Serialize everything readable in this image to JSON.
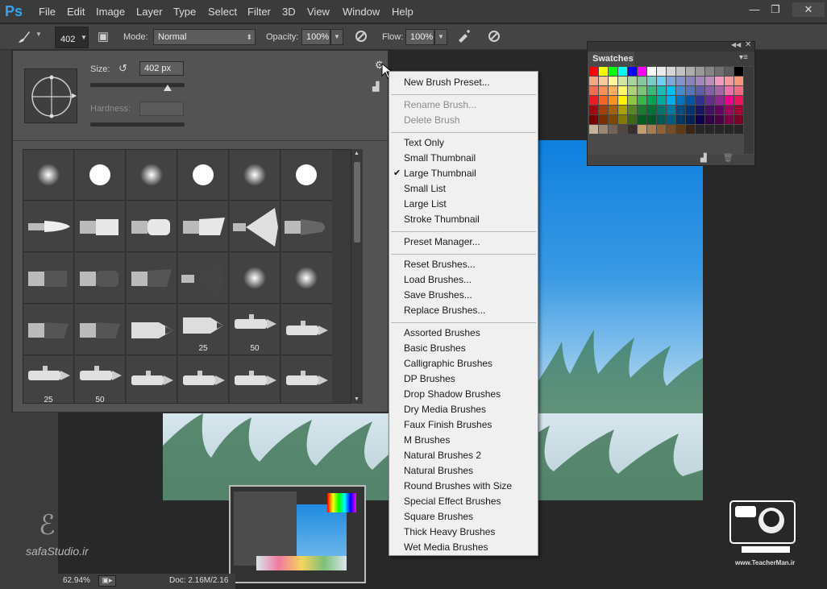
{
  "app": {
    "logo": "Ps"
  },
  "menubar": {
    "items": [
      "File",
      "Edit",
      "Image",
      "Layer",
      "Type",
      "Select",
      "Filter",
      "3D",
      "View",
      "Window",
      "Help"
    ],
    "window_controls": {
      "minimize": "—",
      "restore": "❐",
      "close": "✕"
    }
  },
  "options_bar": {
    "brush_size": "402",
    "mode_label": "Mode:",
    "mode_value": "Normal",
    "opacity_label": "Opacity:",
    "opacity_value": "100%",
    "flow_label": "Flow:",
    "flow_value": "100%"
  },
  "brush_picker": {
    "size_label": "Size:",
    "size_value": "402 px",
    "hardness_label": "Hardness:",
    "size_slider_fraction": 0.82,
    "scroll_fraction": 0.0,
    "row4_labels": [
      "",
      "",
      "",
      "25",
      "50",
      ""
    ],
    "row5_labels": [
      "25",
      "50",
      "",
      "",
      "",
      ""
    ]
  },
  "context_menu": {
    "items": [
      {
        "label": "New Brush Preset...",
        "disabled": false,
        "checked": false
      },
      {
        "sep": true
      },
      {
        "label": "Rename Brush...",
        "disabled": true,
        "checked": false
      },
      {
        "label": "Delete Brush",
        "disabled": true,
        "checked": false
      },
      {
        "sep": true
      },
      {
        "label": "Text Only",
        "disabled": false,
        "checked": false
      },
      {
        "label": "Small Thumbnail",
        "disabled": false,
        "checked": false
      },
      {
        "label": "Large Thumbnail",
        "disabled": false,
        "checked": true
      },
      {
        "label": "Small List",
        "disabled": false,
        "checked": false
      },
      {
        "label": "Large List",
        "disabled": false,
        "checked": false
      },
      {
        "label": "Stroke Thumbnail",
        "disabled": false,
        "checked": false
      },
      {
        "sep": true
      },
      {
        "label": "Preset Manager...",
        "disabled": false,
        "checked": false
      },
      {
        "sep": true
      },
      {
        "label": "Reset Brushes...",
        "disabled": false,
        "checked": false
      },
      {
        "label": "Load Brushes...",
        "disabled": false,
        "checked": false
      },
      {
        "label": "Save Brushes...",
        "disabled": false,
        "checked": false
      },
      {
        "label": "Replace Brushes...",
        "disabled": false,
        "checked": false
      },
      {
        "sep": true
      },
      {
        "label": "Assorted Brushes",
        "disabled": false,
        "checked": false
      },
      {
        "label": "Basic Brushes",
        "disabled": false,
        "checked": false
      },
      {
        "label": "Calligraphic Brushes",
        "disabled": false,
        "checked": false
      },
      {
        "label": "DP Brushes",
        "disabled": false,
        "checked": false
      },
      {
        "label": "Drop Shadow Brushes",
        "disabled": false,
        "checked": false
      },
      {
        "label": "Dry Media Brushes",
        "disabled": false,
        "checked": false
      },
      {
        "label": "Faux Finish Brushes",
        "disabled": false,
        "checked": false
      },
      {
        "label": "M Brushes",
        "disabled": false,
        "checked": false
      },
      {
        "label": "Natural Brushes 2",
        "disabled": false,
        "checked": false
      },
      {
        "label": "Natural Brushes",
        "disabled": false,
        "checked": false
      },
      {
        "label": "Round Brushes with Size",
        "disabled": false,
        "checked": false
      },
      {
        "label": "Special Effect Brushes",
        "disabled": false,
        "checked": false
      },
      {
        "label": "Square Brushes",
        "disabled": false,
        "checked": false
      },
      {
        "label": "Thick Heavy Brushes",
        "disabled": false,
        "checked": false
      },
      {
        "label": "Wet Media Brushes",
        "disabled": false,
        "checked": false
      }
    ]
  },
  "swatches": {
    "title": "Swatches",
    "colors": [
      [
        "#ff0000",
        "#ffff00",
        "#00ff00",
        "#00ffff",
        "#0000ff",
        "#ff00ff",
        "#ffffff",
        "#ebebeb",
        "#d6d6d6",
        "#c2c2c2",
        "#adadad",
        "#999999",
        "#858585",
        "#707070",
        "#5c5c5c",
        "#000000"
      ],
      [
        "#f4a582",
        "#f9c99b",
        "#fff799",
        "#cfe6a4",
        "#a6d39c",
        "#82ca9c",
        "#7accc8",
        "#6dcff6",
        "#7da7d9",
        "#8393ca",
        "#8882be",
        "#a187be",
        "#bd8cbf",
        "#f49ac2",
        "#f6989d",
        "#f7977a"
      ],
      [
        "#f26c4f",
        "#f68e56",
        "#fbaf5d",
        "#fff568",
        "#acd373",
        "#7cc576",
        "#3bb878",
        "#1abbb4",
        "#00bff3",
        "#438ccb",
        "#5574b9",
        "#605ca8",
        "#8560a8",
        "#a763a8",
        "#f06ea9",
        "#f26d7d"
      ],
      [
        "#ed1c24",
        "#f26522",
        "#f7941d",
        "#fff200",
        "#8dc73f",
        "#39b54a",
        "#00a651",
        "#00a99d",
        "#00aeef",
        "#0072bc",
        "#0054a6",
        "#2e3192",
        "#662d91",
        "#92278f",
        "#ec008c",
        "#ed145b"
      ],
      [
        "#9e0b0f",
        "#a0410d",
        "#a36209",
        "#aba000",
        "#598527",
        "#1a7b30",
        "#007236",
        "#00746b",
        "#0076a3",
        "#004b80",
        "#003471",
        "#1b1464",
        "#440e62",
        "#630460",
        "#9e005d",
        "#9e0039"
      ],
      [
        "#790000",
        "#7b2e00",
        "#7d4900",
        "#827b00",
        "#406618",
        "#005e20",
        "#005826",
        "#005952",
        "#005b7f",
        "#003663",
        "#002157",
        "#0d004c",
        "#32004b",
        "#4b0049",
        "#7b0046",
        "#7a0026"
      ],
      [
        "#c7b299",
        "#998675",
        "#736357",
        "#534741",
        "#37302d",
        "#c69c6d",
        "#a67c52",
        "#8c6239",
        "#754c24",
        "#603913",
        "#3c2415",
        "#262626",
        "#262626",
        "#262626",
        "#262626",
        "#262626"
      ]
    ]
  },
  "navigator": {},
  "status": {
    "zoom": "62.94%",
    "doc": "Doc: 2.16M/2.16"
  },
  "watermark": {
    "site_left": "safaStudio.ir",
    "site_right": "www.TeacherMan.ir"
  }
}
